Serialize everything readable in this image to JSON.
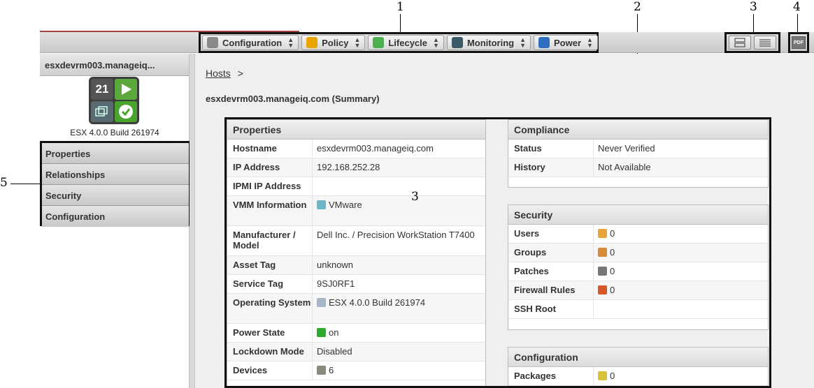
{
  "callouts": {
    "c1": "1",
    "c2": "2",
    "c3a": "3",
    "c3b": "3",
    "c4": "4",
    "c5": "5"
  },
  "toolbar": {
    "buttons": [
      {
        "label": "Configuration",
        "icon": "gear-icon",
        "color": "#8a8a8a"
      },
      {
        "label": "Policy",
        "icon": "shield-icon",
        "color": "#e9a400"
      },
      {
        "label": "Lifecycle",
        "icon": "recycle-icon",
        "color": "#4caf50"
      },
      {
        "label": "Monitoring",
        "icon": "chart-icon",
        "color": "#3b5a6a"
      },
      {
        "label": "Power",
        "icon": "power-icon",
        "color": "#2f6fc2"
      }
    ],
    "pdf_label": "PDF"
  },
  "sidebar": {
    "title": "esxdevrm003.manageiq...",
    "quad_number": "21",
    "caption": "ESX 4.0.0 Build 261974",
    "accordion": [
      "Properties",
      "Relationships",
      "Security",
      "Configuration"
    ]
  },
  "breadcrumb": {
    "link": "Hosts",
    "sep": ">"
  },
  "page_title": "esxdevrm003.manageiq.com (Summary)",
  "properties": {
    "title": "Properties",
    "rows": [
      {
        "k": "Hostname",
        "v": "esxdevrm003.manageiq.com"
      },
      {
        "k": "IP Address",
        "v": "192.168.252.28"
      },
      {
        "k": "IPMI IP Address",
        "v": ""
      },
      {
        "k": "VMM Information",
        "v": "VMware"
      },
      {
        "k": "Manufacturer / Model",
        "v": "Dell Inc. / Precision WorkStation T7400"
      },
      {
        "k": "Asset Tag",
        "v": "unknown"
      },
      {
        "k": "Service Tag",
        "v": "9SJ0RF1"
      },
      {
        "k": "Operating System",
        "v": "ESX 4.0.0 Build 261974"
      },
      {
        "k": "Power State",
        "v": "on"
      },
      {
        "k": "Lockdown Mode",
        "v": "Disabled"
      },
      {
        "k": "Devices",
        "v": "6"
      }
    ]
  },
  "compliance": {
    "title": "Compliance",
    "rows": [
      {
        "k": "Status",
        "v": "Never Verified"
      },
      {
        "k": "History",
        "v": "Not Available"
      }
    ]
  },
  "security": {
    "title": "Security",
    "rows": [
      {
        "k": "Users",
        "v": "0"
      },
      {
        "k": "Groups",
        "v": "0"
      },
      {
        "k": "Patches",
        "v": "0"
      },
      {
        "k": "Firewall Rules",
        "v": "0"
      },
      {
        "k": "SSH Root",
        "v": ""
      }
    ]
  },
  "configuration": {
    "title": "Configuration",
    "rows": [
      {
        "k": "Packages",
        "v": "0"
      }
    ]
  }
}
